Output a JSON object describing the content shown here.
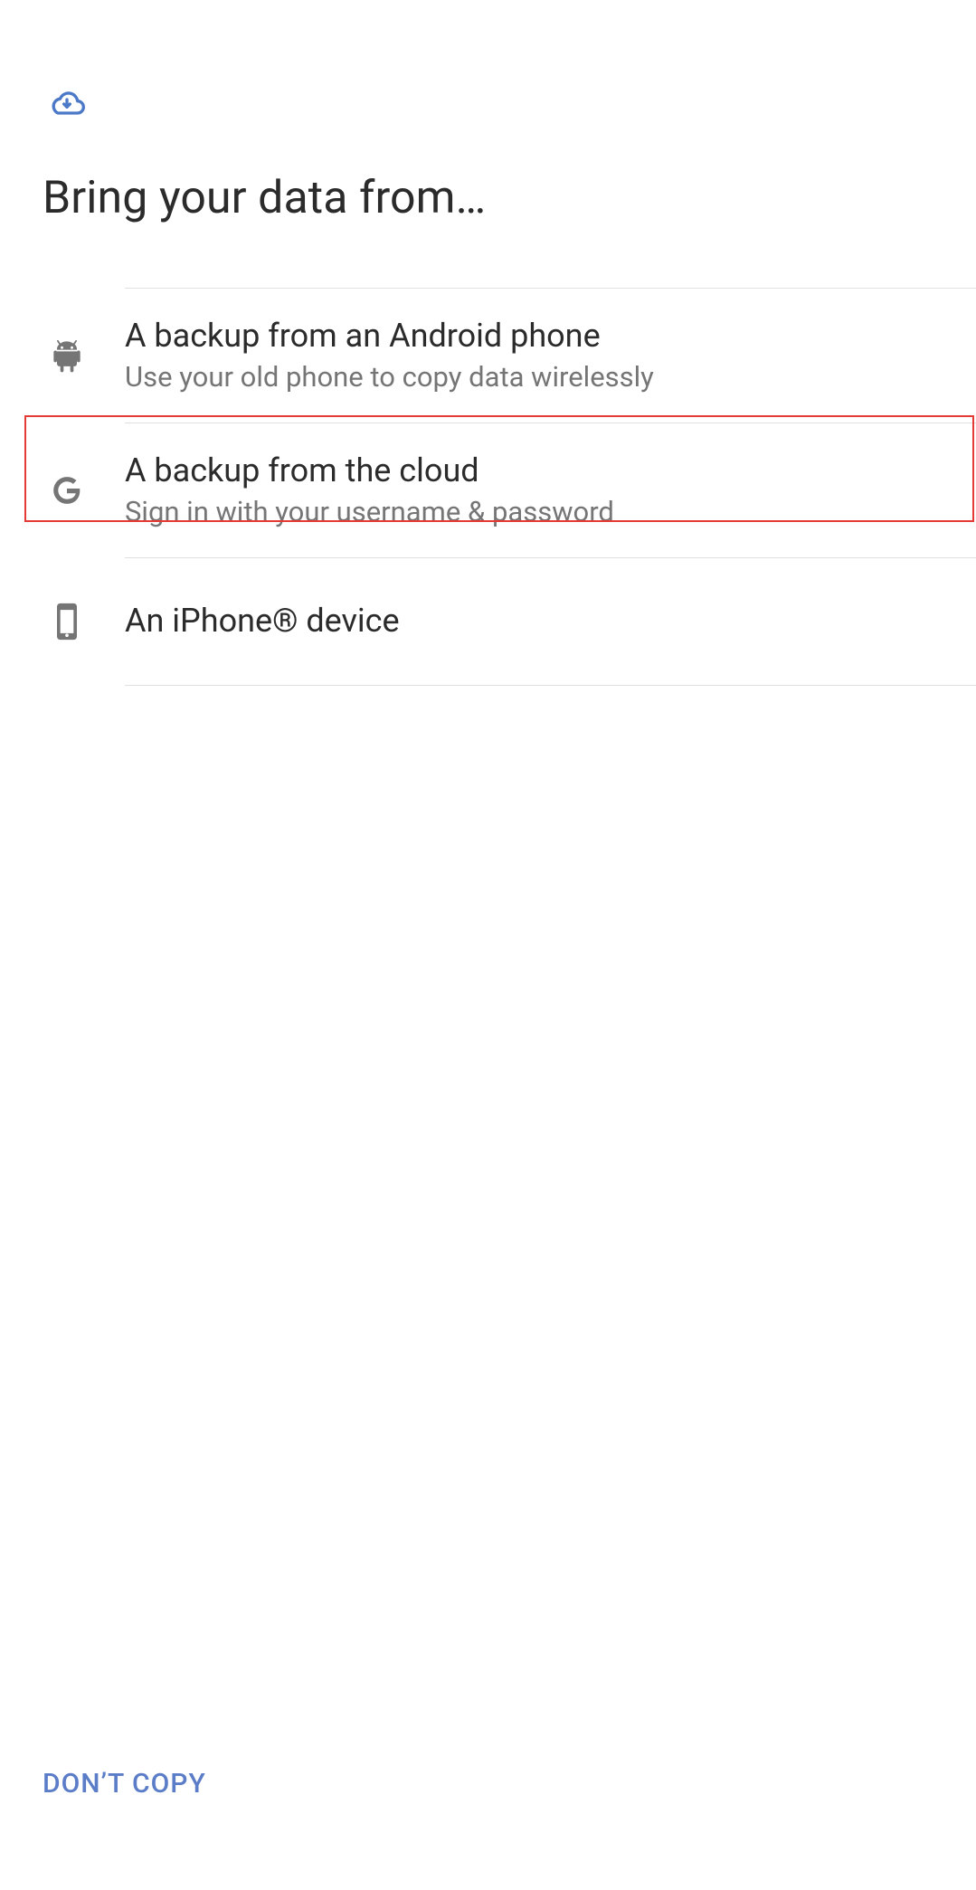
{
  "header": {
    "title": "Bring your data from…"
  },
  "options": [
    {
      "icon": "android-icon",
      "title": "A backup from an Android phone",
      "subtitle": "Use your old phone to copy data wirelessly"
    },
    {
      "icon": "google-g-icon",
      "title": "A backup from the cloud",
      "subtitle": "Sign in with your username & password",
      "highlighted": true
    },
    {
      "icon": "iphone-icon",
      "title": "An iPhone® device",
      "subtitle": ""
    }
  ],
  "footer": {
    "skip_label": "DON’T COPY"
  }
}
